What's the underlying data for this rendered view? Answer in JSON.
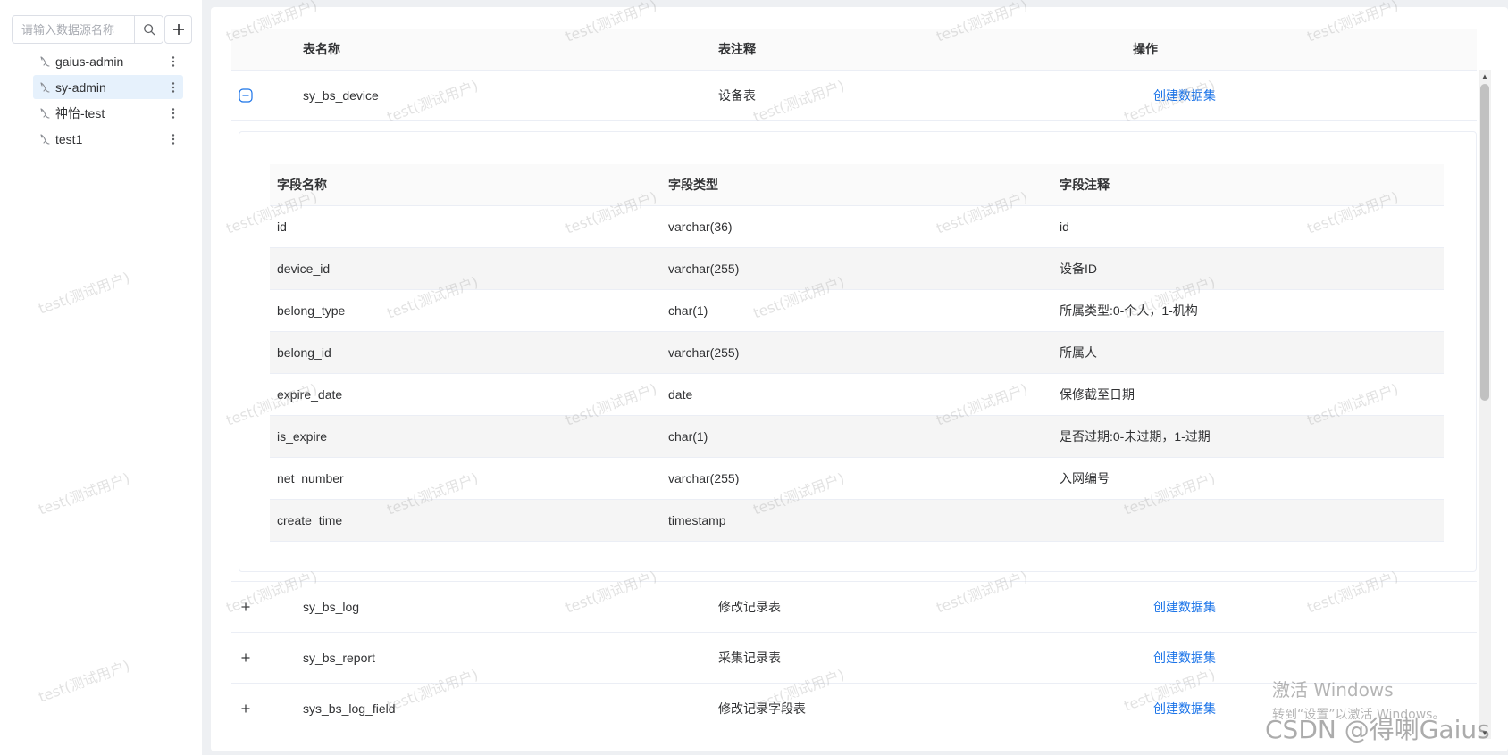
{
  "sidebar": {
    "search": {
      "placeholder": "请输入数据源名称"
    },
    "datasources": [
      {
        "label": "gaius-admin",
        "active": false
      },
      {
        "label": "sy-admin",
        "active": true
      },
      {
        "label": "神怡-test",
        "active": false
      },
      {
        "label": "test1",
        "active": false
      }
    ]
  },
  "table": {
    "headers": {
      "name": "表名称",
      "comment": "表注释",
      "op": "操作"
    },
    "rows": [
      {
        "name": "sy_bs_device",
        "comment": "设备表",
        "action": "创建数据集",
        "expanded": true
      },
      {
        "name": "sy_bs_log",
        "comment": "修改记录表",
        "action": "创建数据集",
        "expanded": false
      },
      {
        "name": "sy_bs_report",
        "comment": "采集记录表",
        "action": "创建数据集",
        "expanded": false
      },
      {
        "name": "sys_bs_log_field",
        "comment": "修改记录字段表",
        "action": "创建数据集",
        "expanded": false
      }
    ]
  },
  "fields": {
    "headers": {
      "name": "字段名称",
      "type": "字段类型",
      "comment": "字段注释"
    },
    "rows": [
      {
        "name": "id",
        "type": "varchar(36)",
        "comment": "id"
      },
      {
        "name": "device_id",
        "type": "varchar(255)",
        "comment": "设备ID"
      },
      {
        "name": "belong_type",
        "type": "char(1)",
        "comment": "所属类型:0-个人，1-机构"
      },
      {
        "name": "belong_id",
        "type": "varchar(255)",
        "comment": "所属人"
      },
      {
        "name": "expire_date",
        "type": "date",
        "comment": "保修截至日期"
      },
      {
        "name": "is_expire",
        "type": "char(1)",
        "comment": "是否过期:0-未过期，1-过期"
      },
      {
        "name": "net_number",
        "type": "varchar(255)",
        "comment": "入网编号"
      },
      {
        "name": "create_time",
        "type": "timestamp",
        "comment": ""
      }
    ]
  },
  "watermark": {
    "text": "test(测试用户)"
  },
  "overlay": {
    "activate_title": "激活 Windows",
    "activate_sub": "转到“设置”以激活 Windows。",
    "csdn": "CSDN @得喇Gaius"
  },
  "colors": {
    "link": "#1a73e8",
    "active_bg": "#e6f1fc",
    "stripe": "#f5f5f5"
  },
  "icons": {
    "search": "search-icon",
    "add": "plus-icon",
    "datasource": "mysql-dolphin-icon",
    "more": "more-vertical-icon",
    "expand": "plus-square-icon",
    "collapse": "minus-square-icon"
  }
}
